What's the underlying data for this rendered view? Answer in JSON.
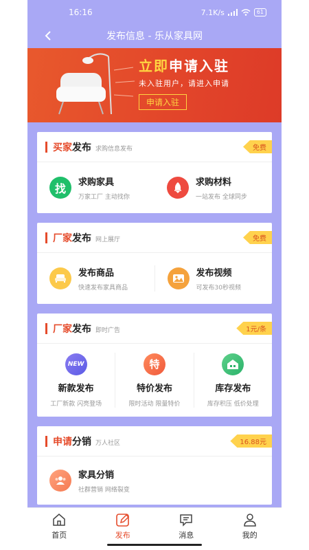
{
  "status": {
    "time": "16:16",
    "speed": "7.1K/s",
    "battery": "61"
  },
  "nav": {
    "title": "发布信息 - 乐从家具网"
  },
  "banner": {
    "headline_a": "立即",
    "headline_b": "申请入驻",
    "sub": "未入驻用户，请进入申请",
    "button": "申请入驻"
  },
  "cards": [
    {
      "title_red": "买家",
      "title_rest": "发布",
      "sub": "求购信息发布",
      "tag": "免费",
      "items": [
        {
          "title": "求购家具",
          "desc": "万家工厂 主动找你",
          "icon": "find-icon",
          "glyph": "找"
        },
        {
          "title": "求购材料",
          "desc": "一站发布 全球同步",
          "icon": "rocket-icon"
        }
      ]
    },
    {
      "title_red": "厂家",
      "title_rest": "发布",
      "sub": "网上展厅",
      "tag": "免费",
      "items": [
        {
          "title": "发布商品",
          "desc": "快速发布家具商品",
          "icon": "sofa-icon"
        },
        {
          "title": "发布视频",
          "desc": "可发布30秒视频",
          "icon": "image-icon"
        }
      ]
    },
    {
      "title_red": "厂家",
      "title_rest": "发布",
      "sub": "即时广告",
      "tag": "1元/条",
      "items": [
        {
          "title": "新款发布",
          "desc": "工厂新款 闪亮登场",
          "icon": "new-badge-icon",
          "glyph": "NEW"
        },
        {
          "title": "特价发布",
          "desc": "限时活动 限量特价",
          "icon": "special-price-icon",
          "glyph": "特"
        },
        {
          "title": "库存发布",
          "desc": "库存积压 低价处理",
          "icon": "warehouse-icon"
        }
      ]
    },
    {
      "title_red": "申请",
      "title_rest": "分销",
      "sub": "万人社区",
      "tag": "16.88元",
      "items": [
        {
          "title": "家具分销",
          "desc": "社群营销 网络裂变",
          "icon": "group-icon"
        }
      ]
    }
  ],
  "tabs": [
    {
      "label": "首页",
      "icon": "home-icon",
      "active": false
    },
    {
      "label": "发布",
      "icon": "edit-icon",
      "active": true
    },
    {
      "label": "消息",
      "icon": "message-icon",
      "active": false
    },
    {
      "label": "我的",
      "icon": "user-icon",
      "active": false
    }
  ],
  "colors": {
    "accent": "#e54b2b",
    "background": "#a9a8f5",
    "tag": "#ffd24d"
  }
}
